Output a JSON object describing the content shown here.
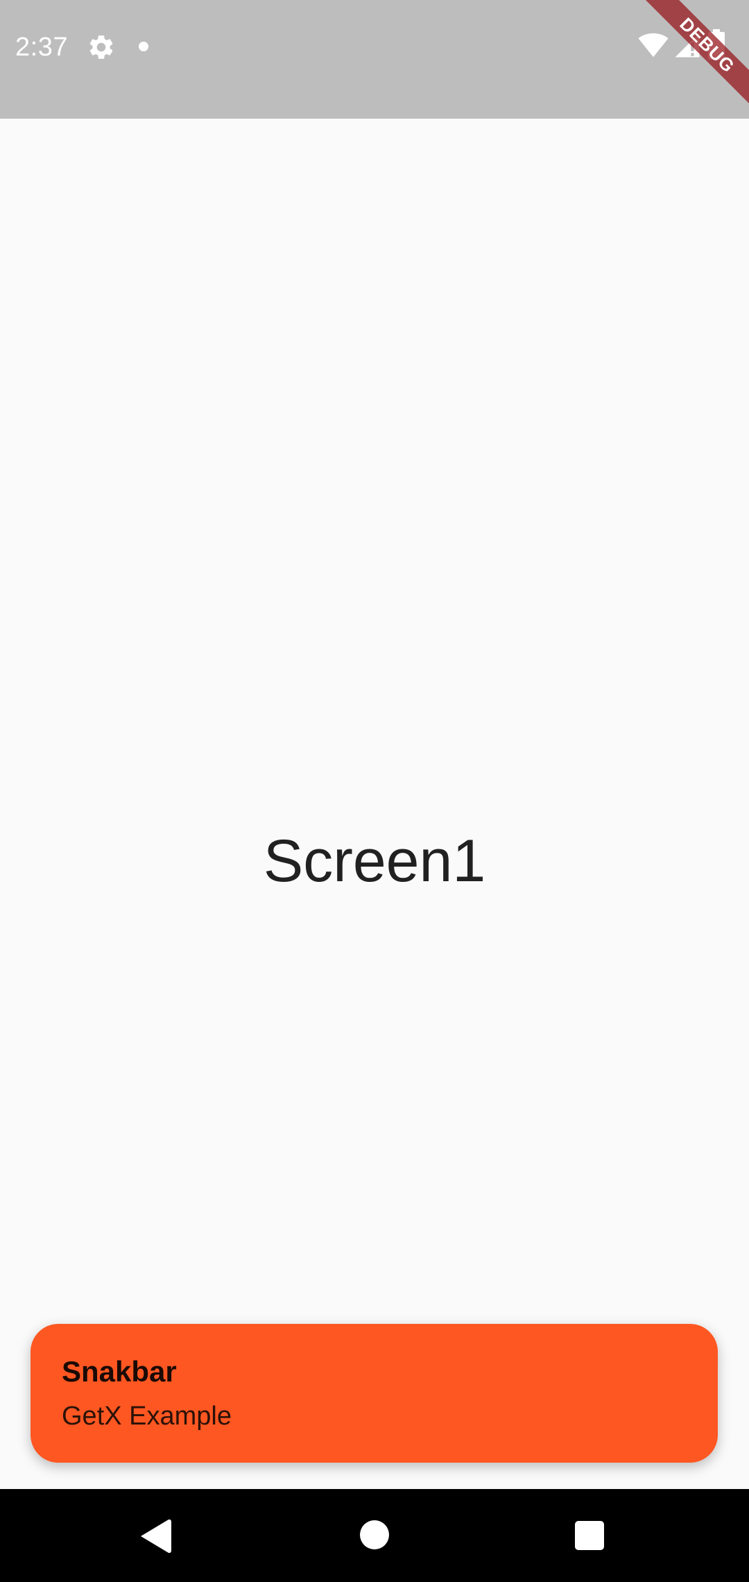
{
  "status_bar": {
    "time": "2:37",
    "icons": [
      "settings-gear-icon",
      "notification-dot-icon",
      "wifi-icon",
      "signal-icon",
      "battery-icon"
    ]
  },
  "debug_banner": {
    "label": "DEBUG"
  },
  "main": {
    "title": "Screen1"
  },
  "snackbar": {
    "title": "Snakbar",
    "message": "GetX Example",
    "background_color": "#ff5722"
  },
  "navigation_bar": {
    "buttons": [
      "back",
      "home",
      "recents"
    ]
  }
}
